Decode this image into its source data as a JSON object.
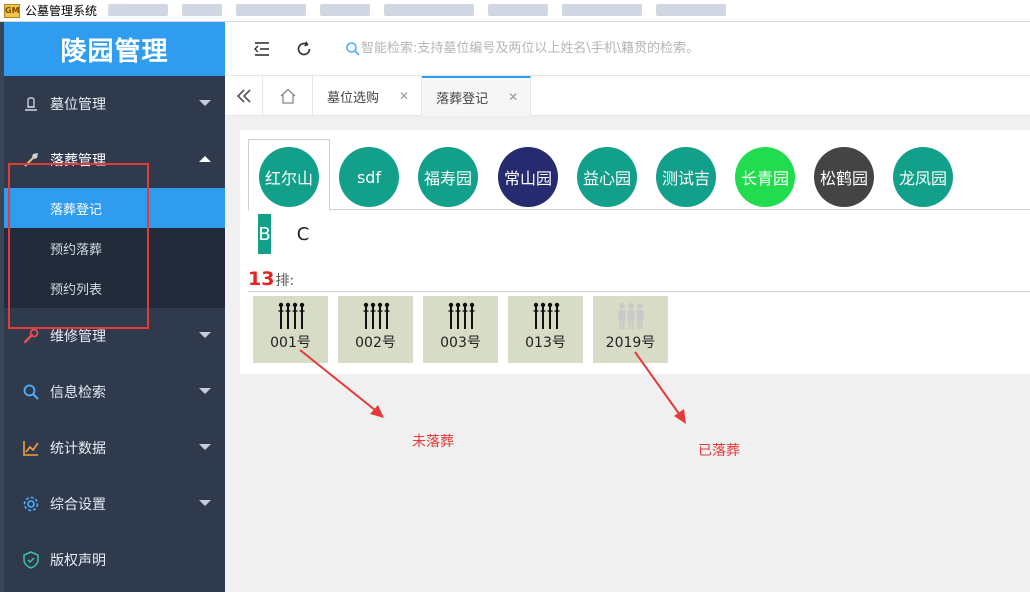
{
  "window": {
    "title": "公墓管理系统",
    "icon": "app-icon"
  },
  "sidebar": {
    "logo": "陵园管理",
    "items": [
      {
        "label": "墓位管理",
        "icon": "tombstone-icon",
        "expanded": false
      },
      {
        "label": "落葬管理",
        "icon": "shovel-icon",
        "expanded": true,
        "children": [
          {
            "label": "落葬登记",
            "active": true
          },
          {
            "label": "预约落葬",
            "active": false
          },
          {
            "label": "预约列表",
            "active": false
          }
        ]
      },
      {
        "label": "维修管理",
        "icon": "wrench-icon",
        "expanded": false
      },
      {
        "label": "信息检索",
        "icon": "search-icon",
        "expanded": false
      },
      {
        "label": "统计数据",
        "icon": "chart-icon",
        "expanded": false
      },
      {
        "label": "综合设置",
        "icon": "gear-icon",
        "expanded": false
      },
      {
        "label": "版权声明",
        "icon": "shield-icon",
        "expanded": false
      }
    ]
  },
  "header": {
    "search_placeholder": "智能检索:支持墓位编号及两位以上姓名\\手机\\籍贯的检索。"
  },
  "tabs": [
    {
      "label": "墓位选购",
      "active": false
    },
    {
      "label": "落葬登记",
      "active": true
    }
  ],
  "cemeteries": [
    {
      "name": "红尔山",
      "color": "#12a08a",
      "active": true
    },
    {
      "name": "sdf",
      "color": "#12a08a",
      "active": false
    },
    {
      "name": "福寿园",
      "color": "#12a08a",
      "active": false
    },
    {
      "name": "常山园",
      "color": "#262a6e",
      "active": false
    },
    {
      "name": "益心园",
      "color": "#12a08a",
      "active": false
    },
    {
      "name": "测试吉",
      "color": "#12a08a",
      "active": false
    },
    {
      "name": "长青园",
      "color": "#22dc4f",
      "active": false
    },
    {
      "name": "松鹤园",
      "color": "#444444",
      "active": false
    },
    {
      "name": "龙凤园",
      "color": "#12a08a",
      "active": false
    }
  ],
  "areas": [
    {
      "name": "B",
      "selected": true
    },
    {
      "name": "C",
      "selected": false
    }
  ],
  "row": {
    "number": "13",
    "suffix": "排:"
  },
  "plots": [
    {
      "label": "001号",
      "buried": false
    },
    {
      "label": "002号",
      "buried": false
    },
    {
      "label": "003号",
      "buried": false
    },
    {
      "label": "013号",
      "buried": false
    },
    {
      "label": "2019号",
      "buried": true
    }
  ],
  "annotations": {
    "not_buried": "未落葬",
    "buried": "已落葬",
    "color": "#e53a3a"
  }
}
